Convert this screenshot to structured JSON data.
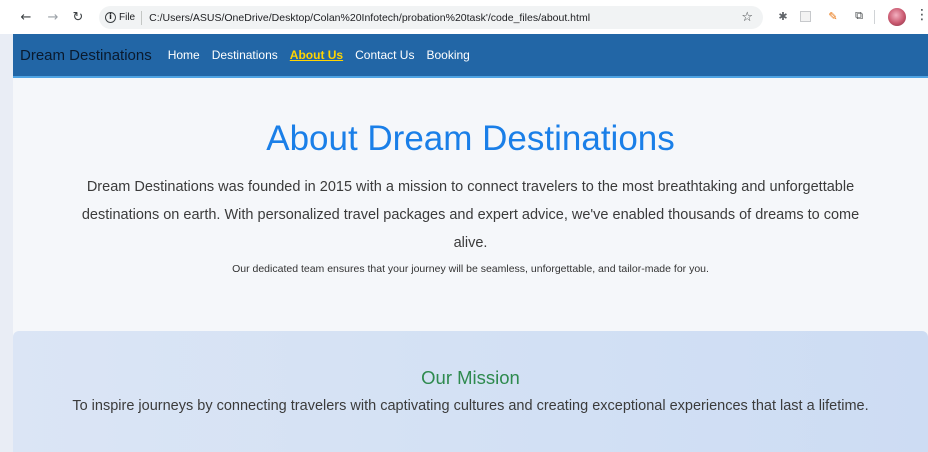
{
  "browser": {
    "file_label": "File",
    "url": "C:/Users/ASUS/OneDrive/Desktop/Colan%20Infotech/probation%20task'/code_files/about.html"
  },
  "navbar": {
    "brand": "Dream Destinations",
    "links": [
      "Home",
      "Destinations",
      "About Us",
      "Contact Us",
      "Booking"
    ],
    "active": "About Us"
  },
  "hero": {
    "title": "About Dream Destinations",
    "lead": "Dream Destinations was founded in 2015 with a mission to connect travelers to the most breathtaking and unforgettable destinations on earth. With personalized travel packages and expert advice, we've enabled thousands of dreams to come alive.",
    "sub": "Our dedicated team ensures that your journey will be seamless, unforgettable, and tailor-made for you."
  },
  "mission": {
    "title": "Our Mission",
    "text": "To inspire journeys by connecting travelers with captivating cultures and creating exceptional experiences that last a lifetime."
  },
  "colors": {
    "navbar_bg": "#2266a6",
    "active_link": "#ffd400",
    "title_blue": "#1a7fe8",
    "mission_green": "#2e8a4e"
  }
}
